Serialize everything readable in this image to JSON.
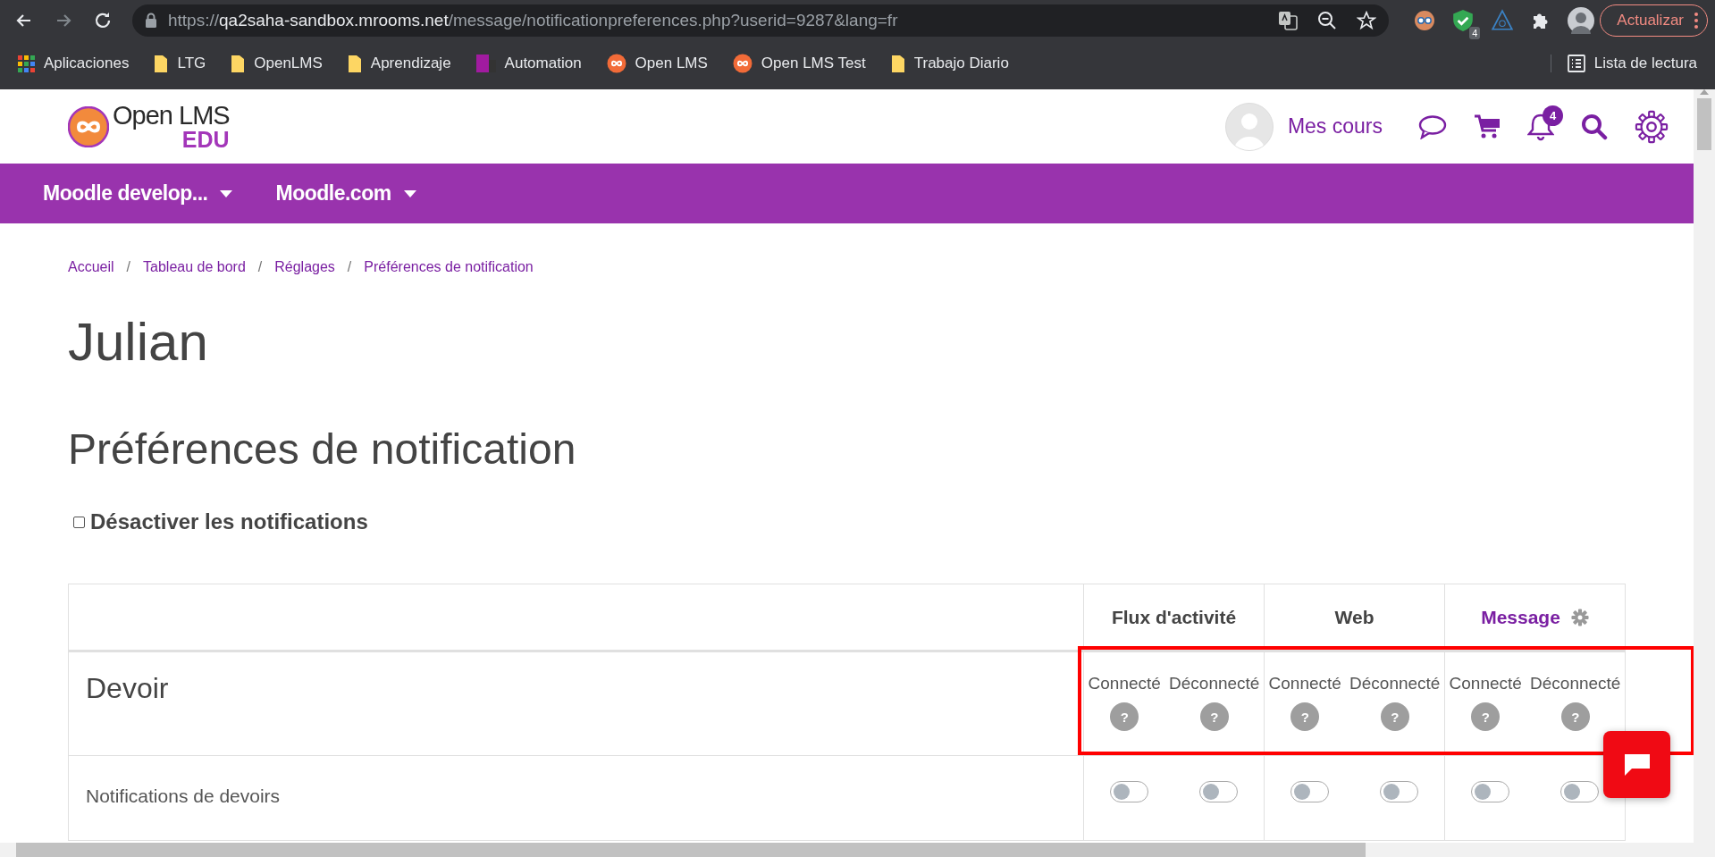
{
  "browser": {
    "url": {
      "scheme": "https://",
      "host": "qa2saha-sandbox.mrooms.net",
      "path": "/message/notificationpreferences.php?userid=9287&lang=fr"
    },
    "extensions": [
      {
        "kind": "face"
      },
      {
        "kind": "shield",
        "badge": "4"
      },
      {
        "kind": "triangle"
      },
      {
        "kind": "puzzle"
      }
    ],
    "update_button": "Actualizar",
    "bookmarks": [
      {
        "kind": "apps",
        "label": "Aplicaciones"
      },
      {
        "kind": "folder",
        "label": "LTG"
      },
      {
        "kind": "folder",
        "label": "OpenLMS"
      },
      {
        "kind": "folder",
        "label": "Aprendizaje"
      },
      {
        "kind": "ltg",
        "label": "Automation"
      },
      {
        "kind": "openlms",
        "label": "Open LMS"
      },
      {
        "kind": "openlms",
        "label": "Open LMS Test"
      },
      {
        "kind": "folder",
        "label": "Trabajo Diario"
      }
    ],
    "reading_list": "Lista de lectura"
  },
  "header": {
    "logo": {
      "name": "Open LMS",
      "sub": "EDU"
    },
    "my_courses": "Mes cours",
    "notification_count": "4"
  },
  "nav": [
    {
      "label": "Moodle develop..."
    },
    {
      "label": "Moodle.com"
    }
  ],
  "breadcrumb": [
    {
      "label": "Accueil"
    },
    {
      "separator": "/",
      "label": "Tableau de bord"
    },
    {
      "separator": "/",
      "label": "Réglages"
    },
    {
      "separator": "/",
      "label": "Préférences de notification"
    }
  ],
  "page_title": "Julian",
  "section_title": "Préférences de notification",
  "disable_notifications": {
    "label": "Désactiver les notifications",
    "checked": false
  },
  "table": {
    "columns": [
      {
        "label": "Flux d'activité",
        "kind": "plain",
        "states": [
          {
            "label": "Connecté",
            "help": "?"
          },
          {
            "label": "Déconnecté",
            "help": "?"
          }
        ]
      },
      {
        "label": "Web",
        "kind": "plain",
        "states": [
          {
            "label": "Connecté",
            "help": "?"
          },
          {
            "label": "Déconnecté",
            "help": "?"
          }
        ]
      },
      {
        "label": "Message",
        "kind": "link",
        "states": [
          {
            "label": "Connecté",
            "help": "?"
          },
          {
            "label": "Déconnecté",
            "help": "?"
          }
        ]
      }
    ],
    "rows": [
      {
        "kind": "component",
        "label": "Devoir",
        "highlighted": true
      },
      {
        "kind": "setting",
        "label": "Notifications de devoirs",
        "toggles": [
          {
            "on": false
          },
          {
            "on": false
          },
          {
            "on": false
          },
          {
            "on": false
          },
          {
            "on": false
          },
          {
            "on": false
          }
        ]
      }
    ]
  }
}
